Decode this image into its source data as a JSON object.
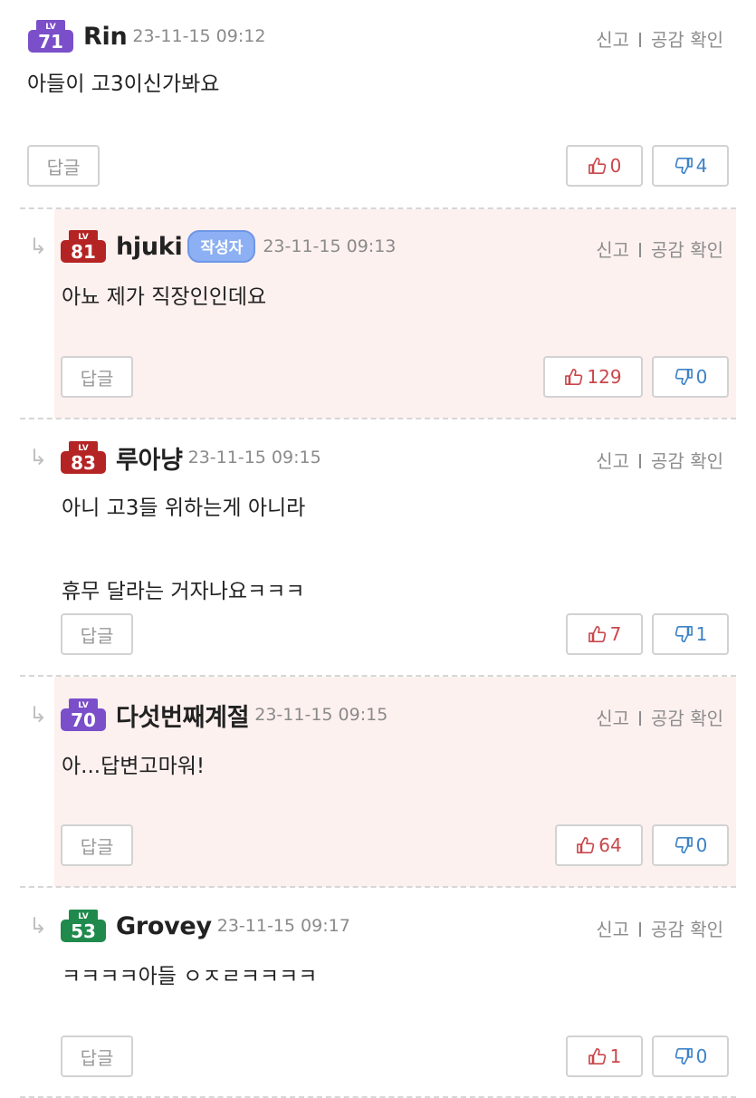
{
  "actions": {
    "report": "신고",
    "likes_check": "공감 확인"
  },
  "reply_button": "답글",
  "comments": [
    {
      "level": "71",
      "level_tag": "LV",
      "badge_color": "#7a4fc9",
      "nickname": "Rin",
      "author_tag": "",
      "time": "23-11-15 09:12",
      "text": [
        "아들이 고3이신가봐요"
      ],
      "likes": "0",
      "dislikes": "4",
      "highlighted": false,
      "is_reply": false
    },
    {
      "level": "81",
      "level_tag": "LV",
      "badge_color": "#b52424",
      "nickname": "hjuki",
      "author_tag": "작성자",
      "time": "23-11-15 09:13",
      "text": [
        "아뇨 제가 직장인인데요"
      ],
      "likes": "129",
      "dislikes": "0",
      "highlighted": true,
      "is_reply": true
    },
    {
      "level": "83",
      "level_tag": "LV",
      "badge_color": "#b52424",
      "nickname": "루아냥",
      "author_tag": "",
      "time": "23-11-15 09:15",
      "text": [
        "아니 고3들 위하는게 아니라",
        "휴무 달라는 거자나요ㅋㅋㅋ"
      ],
      "likes": "7",
      "dislikes": "1",
      "highlighted": false,
      "is_reply": true
    },
    {
      "level": "70",
      "level_tag": "LV",
      "badge_color": "#7a4fc9",
      "nickname": "다섯번째계절",
      "author_tag": "",
      "time": "23-11-15 09:15",
      "text": [
        "아...답변고마워!"
      ],
      "likes": "64",
      "dislikes": "0",
      "highlighted": true,
      "is_reply": true
    },
    {
      "level": "53",
      "level_tag": "LV",
      "badge_color": "#1f8a4c",
      "nickname": "Grovey",
      "author_tag": "",
      "time": "23-11-15 09:17",
      "text": [
        "ㅋㅋㅋㅋ아들 ㅇㅈㄹㅋㅋㅋㅋ"
      ],
      "likes": "1",
      "dislikes": "0",
      "highlighted": false,
      "is_reply": true
    }
  ]
}
